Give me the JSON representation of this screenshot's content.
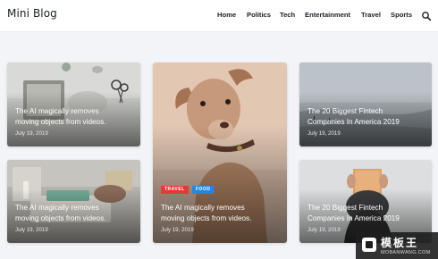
{
  "header": {
    "logo": "Mini Blog",
    "nav": [
      "Home",
      "Politics",
      "Tech",
      "Entertainment",
      "Travel",
      "Sports"
    ],
    "search_icon": "search-icon"
  },
  "cards": [
    {
      "title_lines": [
        "The AI magically removes",
        "moving objects from videos."
      ],
      "date": "July 19, 2019"
    },
    {
      "title_lines": [
        "The AI magically removes",
        "moving objects from videos."
      ],
      "date": "July 19, 2019"
    },
    {
      "title_lines": [
        "The AI magically removes",
        "moving objects from videos."
      ],
      "date": "July 19, 2019",
      "badges": [
        {
          "label": "TRAVEL",
          "color": "#e53935"
        },
        {
          "label": "FOOD",
          "color": "#1e88e5"
        }
      ]
    },
    {
      "title_lines": [
        "The 20 Biggest Fintech",
        "Companies In America 2019"
      ],
      "date": "July 19, 2019"
    },
    {
      "title_lines": [
        "The 20 Biggest Fintech",
        "Companies In America 2019"
      ],
      "date": "July 19, 2019"
    }
  ],
  "watermark": {
    "cn": "模板王",
    "en": "MOBANWANG.COM"
  },
  "colors": {
    "badge_travel": "#e53935",
    "badge_food": "#1e88e5",
    "background": "#f2f4f7"
  }
}
